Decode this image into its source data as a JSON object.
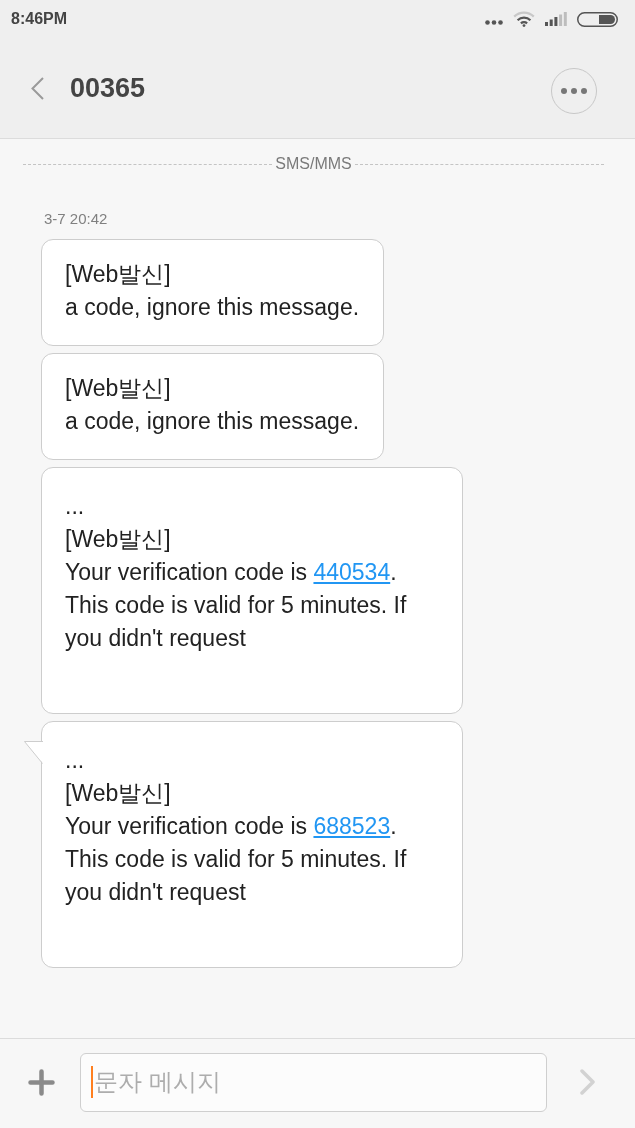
{
  "status_bar": {
    "time": "8:46PM"
  },
  "header": {
    "title": "00365"
  },
  "divider": {
    "label": "SMS/MMS"
  },
  "thread": {
    "timestamp": "3-7 20:42",
    "messages": [
      {
        "kind": "notice",
        "tail": false,
        "lines": [
          {
            "text": "[Web발신]"
          },
          {
            "text": "a code, ignore this message."
          }
        ]
      },
      {
        "kind": "notice",
        "tail": false,
        "lines": [
          {
            "text": "[Web발신]"
          },
          {
            "text": "a code, ignore this message."
          }
        ]
      },
      {
        "kind": "code",
        "tail": false,
        "lines": [
          {
            "text": "..."
          },
          {
            "text": "[Web발신]"
          },
          {
            "text": "Your verification code is ",
            "link": "440534",
            "text_after": "."
          },
          {
            "text": "This code is valid for 5 minutes. If"
          },
          {
            "text": "you didn't request"
          }
        ]
      },
      {
        "kind": "code",
        "tail": true,
        "lines": [
          {
            "text": "..."
          },
          {
            "text": "[Web발신]"
          },
          {
            "text": "Your verification code is ",
            "link": "688523",
            "text_after": "."
          },
          {
            "text": "This code is valid for 5 minutes. If"
          },
          {
            "text": "you didn't request"
          }
        ]
      }
    ]
  },
  "compose": {
    "placeholder": "문자 메시지",
    "focused": true,
    "send_disabled": true
  }
}
